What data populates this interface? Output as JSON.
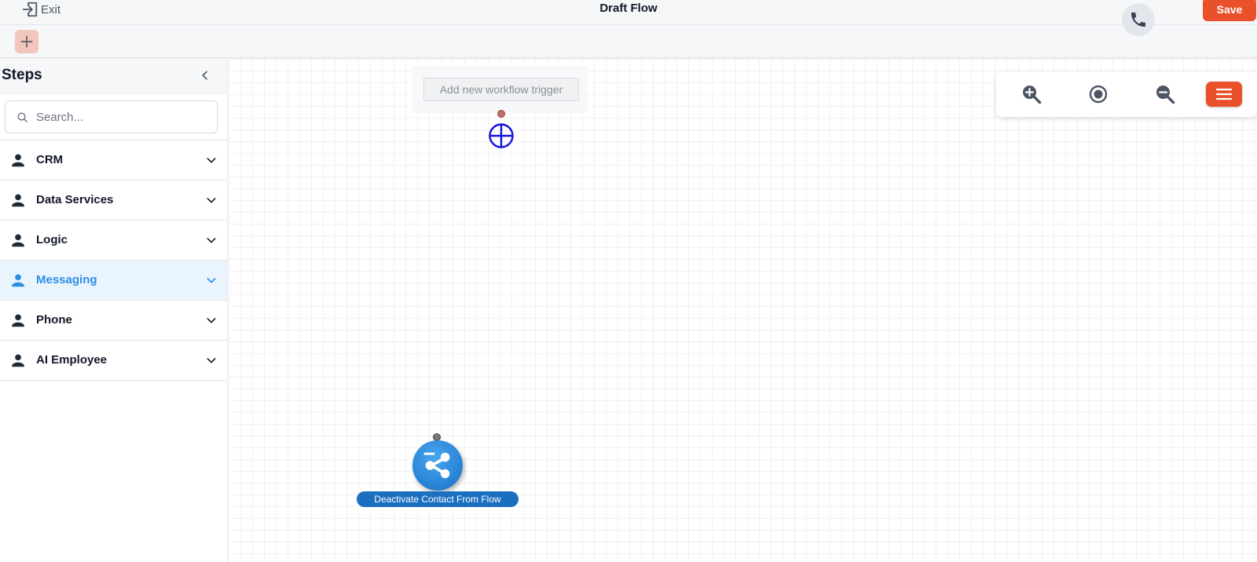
{
  "header": {
    "exit_label": "Exit",
    "title": "Draft Flow",
    "save_label": "Save"
  },
  "sidebar": {
    "title": "Steps",
    "search": {
      "placeholder": "Search...",
      "value": ""
    },
    "items": [
      {
        "label": "CRM",
        "active": false
      },
      {
        "label": "Data Services",
        "active": false
      },
      {
        "label": "Logic",
        "active": false
      },
      {
        "label": "Messaging",
        "active": true
      },
      {
        "label": "Phone",
        "active": false
      },
      {
        "label": "AI Employee",
        "active": false
      }
    ]
  },
  "canvas": {
    "trigger_button_label": "Add new workflow trigger",
    "node": {
      "label": "Deactivate Contact From Flow",
      "icon": "share-icon"
    }
  },
  "colors": {
    "accent": "#e8512a",
    "active": "#2b8fe8",
    "node": "#1a6fc0"
  },
  "icons": [
    "exit-icon",
    "phone-icon",
    "plus-icon",
    "chevron-left-icon",
    "search-icon",
    "person-icon",
    "chevron-down-icon",
    "zoom-in-icon",
    "center-icon",
    "zoom-out-icon",
    "menu-icon",
    "add-node-icon",
    "share-icon"
  ]
}
